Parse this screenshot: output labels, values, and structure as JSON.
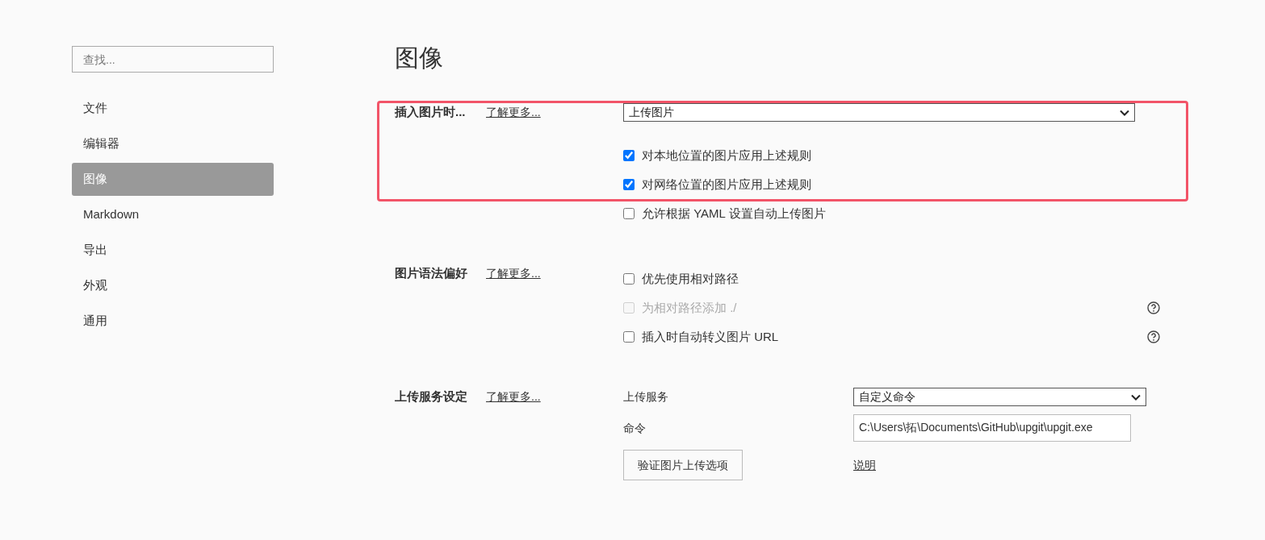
{
  "sidebar": {
    "search": {
      "placeholder": "查找..."
    },
    "items": [
      {
        "label": "文件",
        "selected": false
      },
      {
        "label": "编辑器",
        "selected": false
      },
      {
        "label": "图像",
        "selected": true
      },
      {
        "label": "Markdown",
        "selected": false
      },
      {
        "label": "导出",
        "selected": false
      },
      {
        "label": "外观",
        "selected": false
      },
      {
        "label": "通用",
        "selected": false
      }
    ]
  },
  "page_title": "图像",
  "sections": [
    {
      "label": "插入图片时...",
      "link": "了解更多...",
      "rows": [
        {
          "kind": "select",
          "value": "上传图片",
          "highlighted": true
        },
        {
          "kind": "checkbox",
          "label": "对本地位置的图片应用上述规则",
          "checked": true,
          "disabled": false,
          "help": false,
          "highlighted": true
        },
        {
          "kind": "checkbox",
          "label": "对网络位置的图片应用上述规则",
          "checked": true,
          "disabled": false,
          "help": false,
          "highlighted": true
        },
        {
          "kind": "checkbox",
          "label": "允许根据 YAML 设置自动上传图片",
          "checked": false,
          "disabled": false,
          "help": false,
          "highlighted": false
        }
      ]
    },
    {
      "label": "图片语法偏好",
      "link": "了解更多...",
      "rows": [
        {
          "kind": "checkbox",
          "label": "优先使用相对路径",
          "checked": false,
          "disabled": false,
          "help": false,
          "highlighted": false
        },
        {
          "kind": "checkbox",
          "label": "为相对路径添加 ./",
          "checked": false,
          "disabled": true,
          "help": true,
          "highlighted": false
        },
        {
          "kind": "checkbox",
          "label": "插入时自动转义图片 URL",
          "checked": false,
          "disabled": false,
          "help": true,
          "highlighted": false
        }
      ]
    },
    {
      "label": "上传服务设定",
      "link": "了解更多...",
      "rows": [
        {
          "kind": "labeled_select",
          "label": "上传服务",
          "value": "自定义命令",
          "highlighted": false
        },
        {
          "kind": "labeled_input",
          "label": "命令",
          "value": "C:\\Users\\拓\\Documents\\GitHub\\upgit\\upgit.exe",
          "highlighted": false
        },
        {
          "kind": "button_link",
          "button": "验证图片上传选项",
          "link": "说明",
          "highlighted": false
        }
      ]
    }
  ]
}
